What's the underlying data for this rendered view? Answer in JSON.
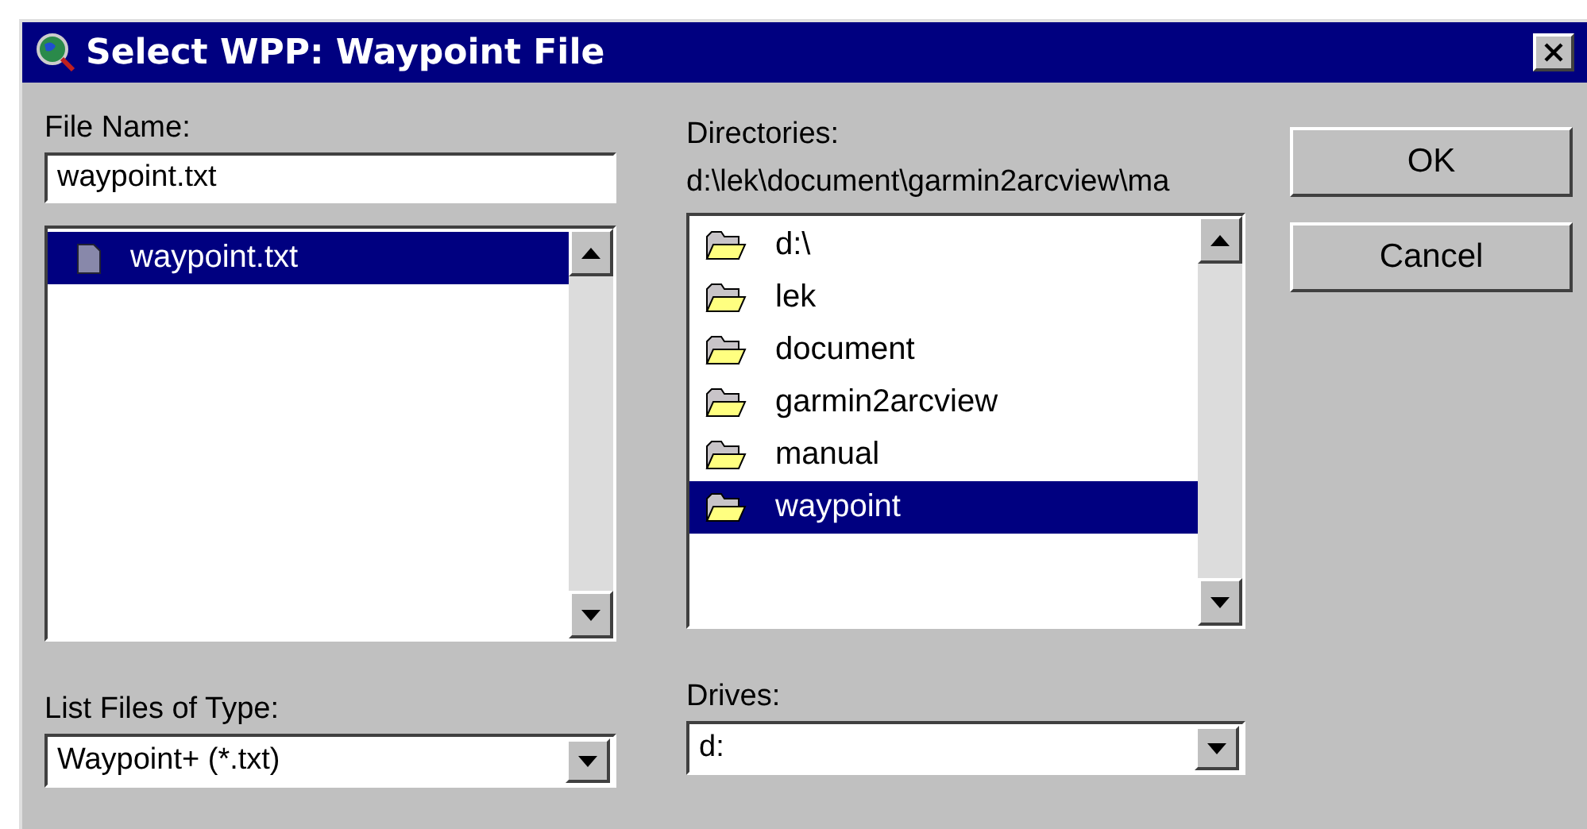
{
  "window": {
    "title": "Select WPP: Waypoint File"
  },
  "file_name": {
    "label": "File Name:",
    "value": "waypoint.txt"
  },
  "files": [
    {
      "name": "waypoint.txt",
      "selected": true
    }
  ],
  "directories": {
    "label": "Directories:",
    "path": "d:\\lek\\document\\garmin2arcview\\ma",
    "items": [
      {
        "name": "d:\\",
        "selected": false
      },
      {
        "name": "lek",
        "selected": false
      },
      {
        "name": "document",
        "selected": false
      },
      {
        "name": "garmin2arcview",
        "selected": false
      },
      {
        "name": "manual",
        "selected": false
      },
      {
        "name": "waypoint",
        "selected": true
      }
    ]
  },
  "file_type": {
    "label": "List Files of Type:",
    "value": "Waypoint+ (*.txt)"
  },
  "drives": {
    "label": "Drives:",
    "value": "d:"
  },
  "buttons": [
    "OK",
    "Cancel"
  ]
}
